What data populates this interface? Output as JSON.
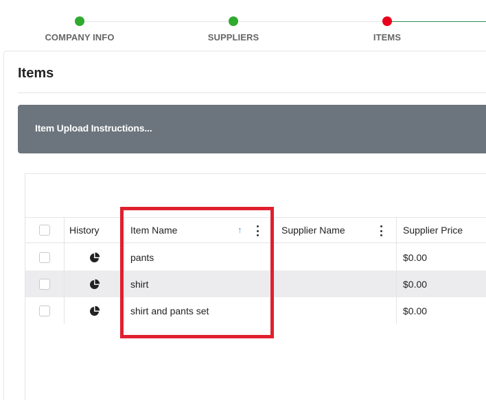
{
  "stepper": {
    "steps": [
      {
        "label": "COMPANY INFO",
        "status": "complete"
      },
      {
        "label": "SUPPLIERS",
        "status": "complete"
      },
      {
        "label": "ITEMS",
        "status": "current"
      }
    ],
    "colors": {
      "complete": "#2faa2f",
      "current": "#e8001c",
      "line_active": "#2e8b57"
    }
  },
  "page": {
    "title": "Items"
  },
  "instructions": {
    "label": "Item Upload Instructions..."
  },
  "grid": {
    "columns": [
      {
        "key": "select",
        "label": ""
      },
      {
        "key": "history",
        "label": "History"
      },
      {
        "key": "item_name",
        "label": "Item Name",
        "sort": "ascending"
      },
      {
        "key": "supplier_name",
        "label": "Supplier Name"
      },
      {
        "key": "supplier_price",
        "label": "Supplier Price"
      }
    ],
    "rows": [
      {
        "item_name": "pants",
        "supplier_name": "",
        "supplier_price": "$0.00",
        "history_icon": "pie-chart-icon"
      },
      {
        "item_name": "shirt",
        "supplier_name": "",
        "supplier_price": "$0.00",
        "history_icon": "pie-chart-icon"
      },
      {
        "item_name": "shirt and pants set",
        "supplier_name": "",
        "supplier_price": "$0.00",
        "history_icon": "pie-chart-icon"
      }
    ]
  },
  "annotation": {
    "color": "#e02030",
    "target": "Item Name column"
  }
}
